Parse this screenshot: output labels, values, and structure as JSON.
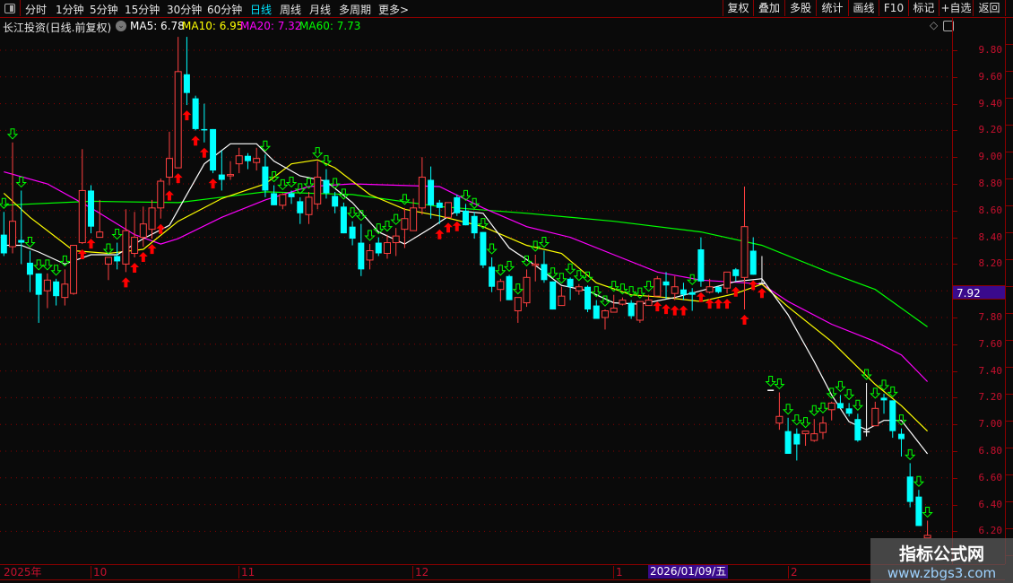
{
  "toolbar": {
    "periods": [
      "分时",
      "1分钟",
      "5分钟",
      "15分钟",
      "30分钟",
      "60分钟",
      "日线",
      "周线",
      "月线",
      "多周期",
      "更多>"
    ],
    "active_period": "日线",
    "right_buttons": [
      "复权",
      "叠加",
      "多股",
      "统计",
      "画线",
      "F10",
      "标记",
      "+自选",
      "返回"
    ]
  },
  "legend": {
    "title": "长江投资(日线.前复权)",
    "ma5": "MA5: 6.78",
    "ma10": "MA10: 6.95",
    "ma20": "MA20: 7.32",
    "ma60": "MA60: 7.73"
  },
  "current_price": "7.92",
  "time_axis": {
    "labels": [
      "2025年",
      "10",
      "11",
      "12",
      "1",
      "2"
    ],
    "highlight_date": "2026/01/09/五"
  },
  "watermark": {
    "title": "指标公式网",
    "url": "www.zbgs3.com"
  },
  "colors": {
    "background": "#0a0a0a",
    "up": "#ff4040",
    "down": "#00ffff",
    "ma5": "#ffffff",
    "ma10": "#ffff00",
    "ma20": "#ff00ff",
    "ma60": "#00ff00",
    "axis_text": "#c8102e",
    "grid": "#8b0000",
    "highlight": "#3a0a8c"
  },
  "chart_data": {
    "type": "candlestick",
    "ylim": [
      6.1,
      9.9
    ],
    "y_ticks": [
      "9.80",
      "9.60",
      "9.40",
      "9.20",
      "9.00",
      "8.80",
      "8.60",
      "8.40",
      "8.20",
      "8.00",
      "7.80",
      "7.60",
      "7.40",
      "7.20",
      "7.00",
      "6.80",
      "6.60",
      "6.40",
      "6.20"
    ],
    "candles_ohlc": [
      [
        8.42,
        8.59,
        8.26,
        8.28
      ],
      [
        8.33,
        9.11,
        8.28,
        8.52
      ],
      [
        8.38,
        8.75,
        8.2,
        8.36
      ],
      [
        8.21,
        8.3,
        7.99,
        8.12
      ],
      [
        8.13,
        8.13,
        7.76,
        7.97
      ],
      [
        8.0,
        8.13,
        7.87,
        8.08
      ],
      [
        8.07,
        8.09,
        7.89,
        7.96
      ],
      [
        7.95,
        8.16,
        7.89,
        8.05
      ],
      [
        7.98,
        8.34,
        7.97,
        8.34
      ],
      [
        8.36,
        9.06,
        8.35,
        8.75
      ],
      [
        8.75,
        8.79,
        8.43,
        8.48
      ],
      [
        8.4,
        8.68,
        8.4,
        8.44
      ],
      [
        8.2,
        8.25,
        8.08,
        8.25
      ],
      [
        8.26,
        8.36,
        8.16,
        8.22
      ],
      [
        8.2,
        8.61,
        8.14,
        8.45
      ],
      [
        8.28,
        8.59,
        8.25,
        8.4
      ],
      [
        8.4,
        8.63,
        8.33,
        8.5
      ],
      [
        8.46,
        8.68,
        8.39,
        8.62
      ],
      [
        8.62,
        8.84,
        8.54,
        8.82
      ],
      [
        8.85,
        9.19,
        8.79,
        8.99
      ],
      [
        8.92,
        9.9,
        8.92,
        9.64
      ],
      [
        9.62,
        9.9,
        9.39,
        9.48
      ],
      [
        9.44,
        9.46,
        9.2,
        9.21
      ],
      [
        9.21,
        9.4,
        9.11,
        9.2
      ],
      [
        9.21,
        9.21,
        8.88,
        8.9
      ],
      [
        8.87,
        9.05,
        8.75,
        8.83
      ],
      [
        8.86,
        8.97,
        8.83,
        8.87
      ],
      [
        8.95,
        9.07,
        8.88,
        9.01
      ],
      [
        9.01,
        9.03,
        8.91,
        8.97
      ],
      [
        8.96,
        9.07,
        8.9,
        8.99
      ],
      [
        8.93,
        9.02,
        8.7,
        8.75
      ],
      [
        8.73,
        8.79,
        8.64,
        8.64
      ],
      [
        8.64,
        8.73,
        8.61,
        8.72
      ],
      [
        8.73,
        8.75,
        8.65,
        8.7
      ],
      [
        8.67,
        8.7,
        8.5,
        8.58
      ],
      [
        8.57,
        8.74,
        8.5,
        8.7
      ],
      [
        8.65,
        8.97,
        8.61,
        8.85
      ],
      [
        8.83,
        8.91,
        8.69,
        8.73
      ],
      [
        8.71,
        8.74,
        8.58,
        8.63
      ],
      [
        8.63,
        8.66,
        8.43,
        8.43
      ],
      [
        8.48,
        8.52,
        8.34,
        8.39
      ],
      [
        8.36,
        8.5,
        8.11,
        8.16
      ],
      [
        8.23,
        8.35,
        8.16,
        8.3
      ],
      [
        8.36,
        8.4,
        8.26,
        8.28
      ],
      [
        8.28,
        8.42,
        8.24,
        8.36
      ],
      [
        8.36,
        8.47,
        8.26,
        8.41
      ],
      [
        8.46,
        8.62,
        8.32,
        8.54
      ],
      [
        8.45,
        8.69,
        8.45,
        8.62
      ],
      [
        8.62,
        9.0,
        8.57,
        8.85
      ],
      [
        8.83,
        8.93,
        8.54,
        8.64
      ],
      [
        8.66,
        8.68,
        8.5,
        8.62
      ],
      [
        8.55,
        8.66,
        8.55,
        8.66
      ],
      [
        8.7,
        8.72,
        8.56,
        8.58
      ],
      [
        8.6,
        8.65,
        8.49,
        8.49
      ],
      [
        8.56,
        8.59,
        8.39,
        8.43
      ],
      [
        8.44,
        8.44,
        8.17,
        8.19
      ],
      [
        8.18,
        8.25,
        7.99,
        8.03
      ],
      [
        8.01,
        8.09,
        7.92,
        8.07
      ],
      [
        8.11,
        8.12,
        7.93,
        7.93
      ],
      [
        7.85,
        7.95,
        7.76,
        7.95
      ],
      [
        7.91,
        8.16,
        7.88,
        8.1
      ],
      [
        8.19,
        8.27,
        8.07,
        8.2
      ],
      [
        8.2,
        8.3,
        8.06,
        8.08
      ],
      [
        8.07,
        8.07,
        7.86,
        7.86
      ],
      [
        7.89,
        8.03,
        7.89,
        7.96
      ],
      [
        8.09,
        8.1,
        7.93,
        8.03
      ],
      [
        8.0,
        8.05,
        7.97,
        8.03
      ],
      [
        8.03,
        8.04,
        7.84,
        7.86
      ],
      [
        7.89,
        7.93,
        7.79,
        7.79
      ],
      [
        7.8,
        7.86,
        7.71,
        7.85
      ],
      [
        7.84,
        7.97,
        7.84,
        7.87
      ],
      [
        7.9,
        7.95,
        7.89,
        7.93
      ],
      [
        7.91,
        7.93,
        7.79,
        7.81
      ],
      [
        7.78,
        7.92,
        7.76,
        7.92
      ],
      [
        7.89,
        7.97,
        7.89,
        7.93
      ],
      [
        7.96,
        8.11,
        7.96,
        8.09
      ],
      [
        8.07,
        8.14,
        7.94,
        8.04
      ],
      [
        7.98,
        8.11,
        7.93,
        8.03
      ],
      [
        8.01,
        8.06,
        7.93,
        7.97
      ],
      [
        7.99,
        8.02,
        7.85,
        7.97
      ],
      [
        8.31,
        8.4,
        8.03,
        8.07
      ],
      [
        7.99,
        8.09,
        7.98,
        8.03
      ],
      [
        8.03,
        8.03,
        7.98,
        7.99
      ],
      [
        8.02,
        8.14,
        7.98,
        8.14
      ],
      [
        8.16,
        8.17,
        8.07,
        8.11
      ],
      [
        8.1,
        8.78,
        7.86,
        8.48
      ],
      [
        8.3,
        8.4,
        8.12,
        8.12
      ],
      [
        8.06,
        8.26,
        8.06,
        8.06
      ],
      [
        7.26,
        7.26,
        7.26,
        7.26
      ],
      [
        7.01,
        7.24,
        6.96,
        7.06
      ],
      [
        6.95,
        7.05,
        6.78,
        6.78
      ],
      [
        6.93,
        6.97,
        6.73,
        6.85
      ],
      [
        6.93,
        6.95,
        6.84,
        6.95
      ],
      [
        6.88,
        7.04,
        6.87,
        6.93
      ],
      [
        6.94,
        7.06,
        6.89,
        7.01
      ],
      [
        7.11,
        7.17,
        7.03,
        7.16
      ],
      [
        7.16,
        7.22,
        7.12,
        7.12
      ],
      [
        7.12,
        7.16,
        7.06,
        7.08
      ],
      [
        7.04,
        7.08,
        6.87,
        6.88
      ],
      [
        6.95,
        7.31,
        6.91,
        6.95
      ],
      [
        6.99,
        7.17,
        6.99,
        7.12
      ],
      [
        7.2,
        7.23,
        7.08,
        7.18
      ],
      [
        7.18,
        7.18,
        6.9,
        6.95
      ],
      [
        6.93,
        6.97,
        6.76,
        6.89
      ],
      [
        6.61,
        6.71,
        6.38,
        6.42
      ],
      [
        6.46,
        6.51,
        6.24,
        6.24
      ],
      [
        6.15,
        6.28,
        6.15,
        6.17
      ]
    ],
    "buy_signals": [
      9,
      10,
      14,
      15,
      16,
      17,
      18,
      19,
      20,
      21,
      22,
      23,
      24,
      50,
      51,
      52,
      75,
      76,
      77,
      78,
      80,
      81,
      82,
      83,
      84,
      85,
      86,
      87
    ],
    "sell_signals": [
      0,
      1,
      2,
      3,
      4,
      5,
      6,
      7,
      12,
      13,
      30,
      31,
      32,
      33,
      34,
      35,
      36,
      37,
      38,
      39,
      40,
      41,
      42,
      43,
      44,
      45,
      46,
      53,
      54,
      55,
      56,
      57,
      58,
      59,
      60,
      61,
      62,
      63,
      64,
      65,
      66,
      67,
      68,
      69,
      70,
      71,
      72,
      73,
      74,
      79,
      88,
      89,
      90,
      91,
      92,
      93,
      94,
      95,
      96,
      97,
      98,
      99,
      100,
      101,
      102,
      103,
      104,
      105,
      106
    ],
    "series": [
      {
        "name": "MA5",
        "points": [
          [
            0,
            8.34
          ],
          [
            2,
            8.34
          ],
          [
            4,
            8.29
          ],
          [
            7,
            8.2
          ],
          [
            10,
            8.27
          ],
          [
            13,
            8.27
          ],
          [
            16,
            8.39
          ],
          [
            19,
            8.49
          ],
          [
            21,
            8.72
          ],
          [
            23,
            8.95
          ],
          [
            26,
            9.1
          ],
          [
            29,
            9.1
          ],
          [
            31,
            8.97
          ],
          [
            34,
            8.86
          ],
          [
            37,
            8.82
          ],
          [
            40,
            8.66
          ],
          [
            43,
            8.44
          ],
          [
            46,
            8.35
          ],
          [
            49,
            8.47
          ],
          [
            52,
            8.6
          ],
          [
            55,
            8.58
          ],
          [
            58,
            8.32
          ],
          [
            61,
            8.19
          ],
          [
            64,
            8.04
          ],
          [
            67,
            8.0
          ],
          [
            70,
            7.91
          ],
          [
            73,
            7.9
          ],
          [
            77,
            7.95
          ],
          [
            80,
            8.0
          ],
          [
            84,
            8.07
          ],
          [
            87,
            8.09
          ],
          [
            90,
            7.82
          ],
          [
            93,
            7.47
          ],
          [
            95,
            7.22
          ],
          [
            97,
            7.02
          ],
          [
            99,
            6.96
          ],
          [
            101,
            7.03
          ],
          [
            103,
            7.03
          ],
          [
            106,
            6.78
          ]
        ]
      },
      {
        "name": "MA10",
        "points": [
          [
            0,
            8.73
          ],
          [
            3,
            8.55
          ],
          [
            8,
            8.3
          ],
          [
            12,
            8.28
          ],
          [
            16,
            8.31
          ],
          [
            20,
            8.52
          ],
          [
            25,
            8.69
          ],
          [
            30,
            8.8
          ],
          [
            33,
            8.95
          ],
          [
            36,
            8.98
          ],
          [
            38,
            8.92
          ],
          [
            42,
            8.72
          ],
          [
            46,
            8.61
          ],
          [
            50,
            8.56
          ],
          [
            55,
            8.48
          ],
          [
            60,
            8.34
          ],
          [
            64,
            8.28
          ],
          [
            68,
            8.06
          ],
          [
            72,
            7.97
          ],
          [
            76,
            7.95
          ],
          [
            80,
            7.92
          ],
          [
            84,
            7.98
          ],
          [
            87,
            8.05
          ],
          [
            90,
            7.88
          ],
          [
            95,
            7.62
          ],
          [
            100,
            7.3
          ],
          [
            103,
            7.14
          ],
          [
            106,
            6.95
          ]
        ]
      },
      {
        "name": "MA20",
        "points": [
          [
            0,
            8.89
          ],
          [
            5,
            8.8
          ],
          [
            10,
            8.62
          ],
          [
            15,
            8.42
          ],
          [
            18,
            8.35
          ],
          [
            20,
            8.39
          ],
          [
            25,
            8.55
          ],
          [
            30,
            8.68
          ],
          [
            35,
            8.78
          ],
          [
            40,
            8.8
          ],
          [
            50,
            8.78
          ],
          [
            55,
            8.62
          ],
          [
            60,
            8.48
          ],
          [
            65,
            8.4
          ],
          [
            70,
            8.27
          ],
          [
            75,
            8.14
          ],
          [
            80,
            8.08
          ],
          [
            85,
            8.06
          ],
          [
            87,
            8.05
          ],
          [
            90,
            7.92
          ],
          [
            95,
            7.75
          ],
          [
            100,
            7.62
          ],
          [
            103,
            7.52
          ],
          [
            106,
            7.32
          ]
        ]
      },
      {
        "name": "MA60",
        "points": [
          [
            0,
            8.64
          ],
          [
            10,
            8.67
          ],
          [
            20,
            8.66
          ],
          [
            30,
            8.74
          ],
          [
            40,
            8.72
          ],
          [
            50,
            8.63
          ],
          [
            60,
            8.58
          ],
          [
            70,
            8.52
          ],
          [
            80,
            8.44
          ],
          [
            87,
            8.34
          ],
          [
            95,
            8.13
          ],
          [
            100,
            8.01
          ],
          [
            106,
            7.73
          ]
        ]
      }
    ]
  }
}
